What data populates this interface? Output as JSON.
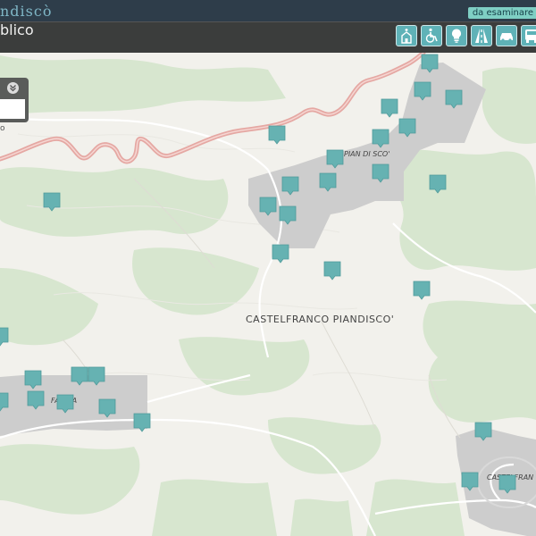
{
  "header": {
    "app_title": "ndiscò",
    "status_badge": "da esaminare"
  },
  "subheader": {
    "page_subtitle": "blico"
  },
  "category_buttons": [
    {
      "name": "church-icon"
    },
    {
      "name": "wheelchair-icon"
    },
    {
      "name": "lightbulb-icon"
    },
    {
      "name": "road-icon"
    },
    {
      "name": "car-icon"
    },
    {
      "name": "bus-icon"
    }
  ],
  "side_panel": {
    "label": "o"
  },
  "map": {
    "labels": {
      "pian_di_sco": "PIAN DI SCO'",
      "castelfranco": "CASTELFRANCO PIANDISCO'",
      "faella": "FAELLA",
      "castelfranco_town": "CASTELFRAN"
    },
    "colors": {
      "background": "#f2f1ec",
      "vegetation": "#d7e6cf",
      "urban_area": "#cdcdcd",
      "main_road": "#e5a8a3",
      "marker": "#66b2b2"
    }
  }
}
